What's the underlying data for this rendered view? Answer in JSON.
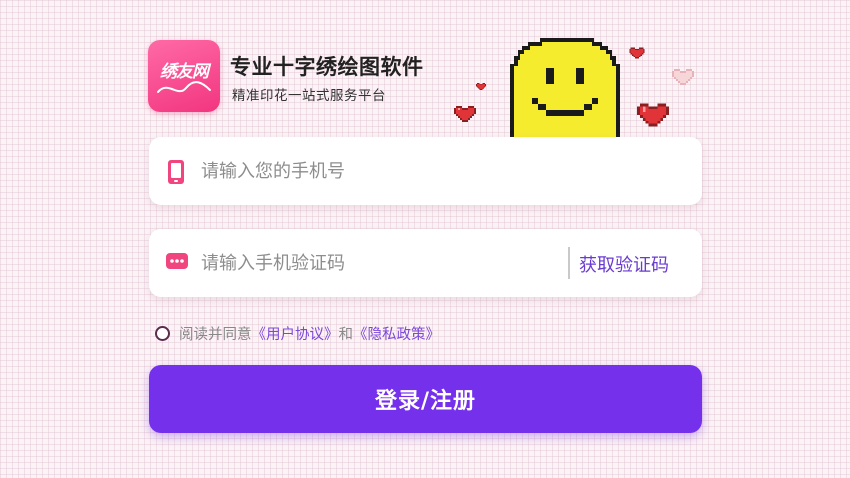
{
  "brand": {
    "logo_text": "绣友网",
    "title": "专业十字绣绘图软件",
    "subtitle": "精准印花一站式服务平台"
  },
  "phone_field": {
    "placeholder": "请输入您的手机号",
    "value": "",
    "icon": "phone-icon"
  },
  "code_field": {
    "placeholder": "请输入手机验证码",
    "value": "",
    "icon": "message-icon",
    "get_code_label": "获取验证码"
  },
  "agreement": {
    "checked": false,
    "prefix": "阅读并同意",
    "user_agreement": "《用户协议》",
    "conjunction": "和",
    "privacy_policy": "《隐私政策》"
  },
  "login_button": "登录/注册",
  "decorations": {
    "mascot": "pixel-smiley",
    "hearts": "pixel-hearts"
  },
  "colors": {
    "primary": "#7530ec",
    "brand_pink": "#f2357f",
    "link": "#7b48d8"
  }
}
